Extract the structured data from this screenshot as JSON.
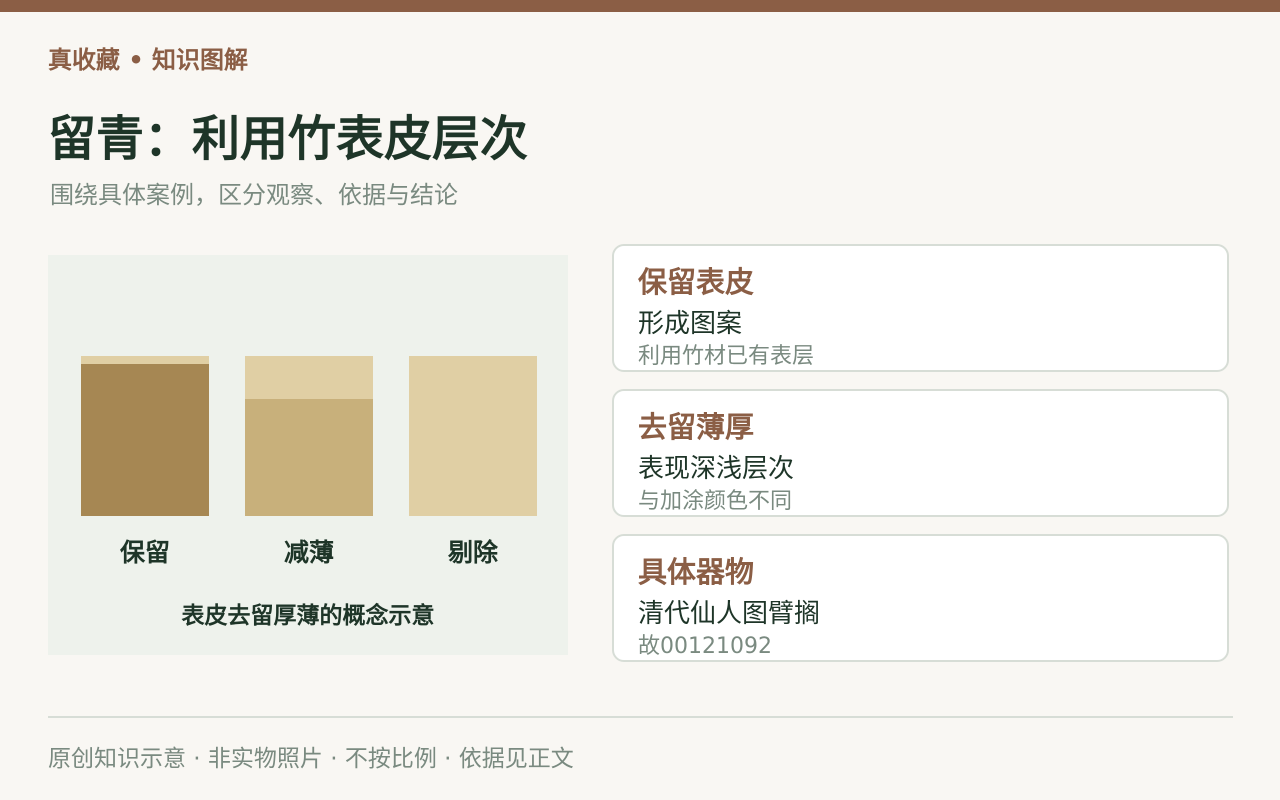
{
  "brand": "真收藏 • 知识图解",
  "title": "留青：利用竹表皮层次",
  "subtitle": "围绕具体案例，区分观察、依据与结论",
  "diagram": {
    "caption": "表皮去留厚薄的概念示意",
    "skin_color": "#e0cfa4",
    "blocks": [
      {
        "label": "保留",
        "remain_fraction": 0.95,
        "remain_color": "#a68753"
      },
      {
        "label": "减薄",
        "remain_fraction": 0.73,
        "remain_color": "#c8b07b"
      },
      {
        "label": "剔除",
        "remain_fraction": 0,
        "remain_color": "#e0cfa4"
      }
    ]
  },
  "cards": [
    {
      "title": "保留表皮",
      "body": "形成图案",
      "note": "利用竹材已有表层"
    },
    {
      "title": "去留薄厚",
      "body": "表现深浅层次",
      "note": "与加涂颜色不同"
    },
    {
      "title": "具体器物",
      "body": "清代仙人图臂搁",
      "note": "故00121092"
    }
  ],
  "footer": "原创知识示意 · 非实物照片 · 不按比例 · 依据见正文",
  "colors": {
    "accent": "#8b5e45",
    "heading": "#1e3528",
    "muted": "#7a8a80",
    "panel_bg": "#eef2ec",
    "page_bg": "#f9f7f3"
  }
}
